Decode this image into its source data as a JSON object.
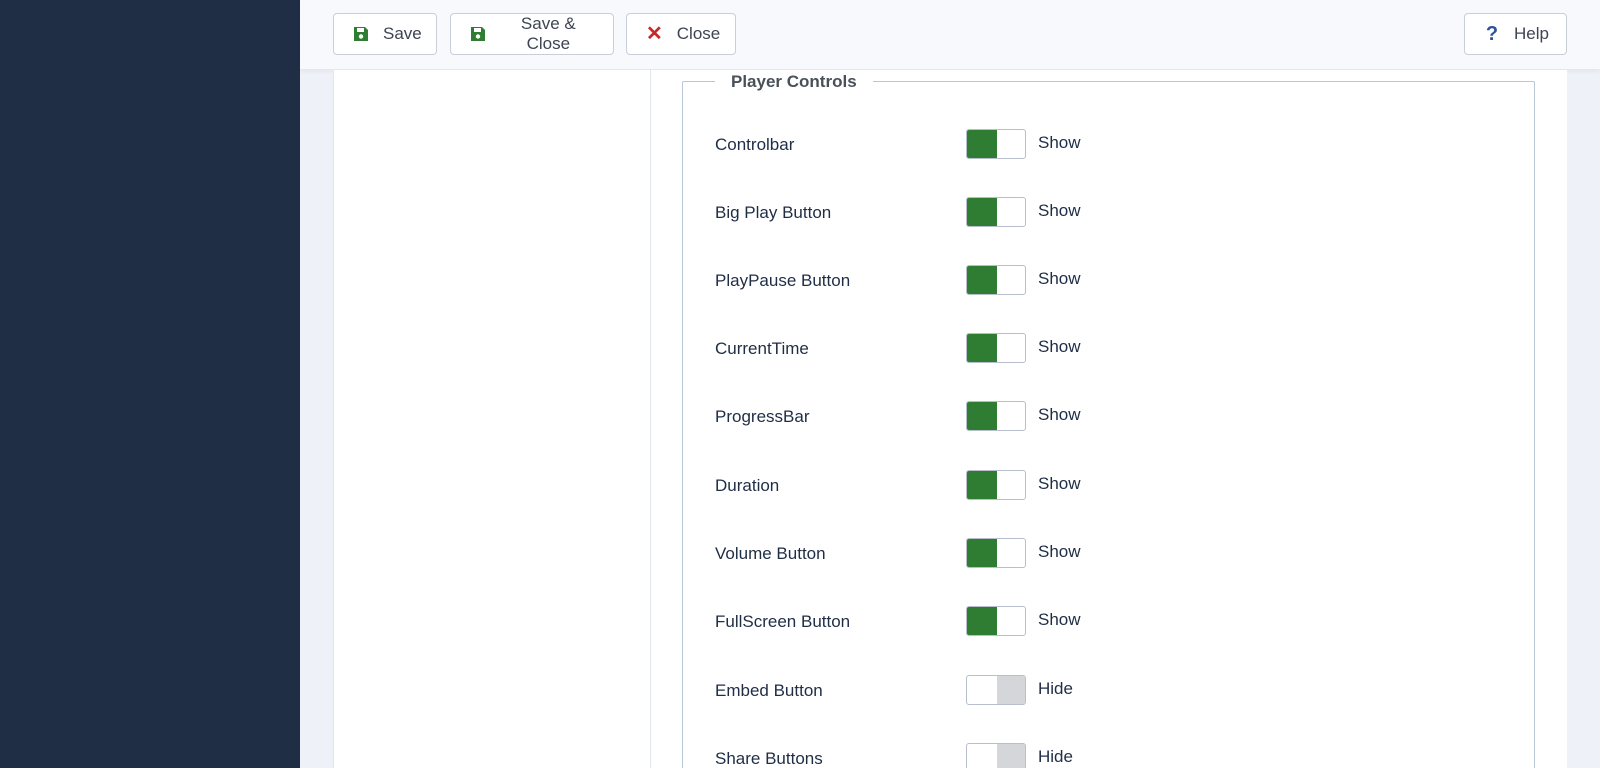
{
  "toolbar": {
    "save_label": "Save",
    "save_close_label": "Save & Close",
    "close_label": "Close",
    "help_label": "Help"
  },
  "colors": {
    "sidebar": "#1f2d45",
    "toggle_on": "#2e7d32",
    "toggle_off": "#d4d6d9",
    "close_icon": "#c62828",
    "help_icon": "#2a5598"
  },
  "fieldset": {
    "legend": "Player Controls",
    "rows": [
      {
        "label": "Controlbar",
        "state": "Show",
        "on": true
      },
      {
        "label": "Big Play Button",
        "state": "Show",
        "on": true
      },
      {
        "label": "PlayPause Button",
        "state": "Show",
        "on": true
      },
      {
        "label": "CurrentTime",
        "state": "Show",
        "on": true
      },
      {
        "label": "ProgressBar",
        "state": "Show",
        "on": true
      },
      {
        "label": "Duration",
        "state": "Show",
        "on": true
      },
      {
        "label": "Volume Button",
        "state": "Show",
        "on": true
      },
      {
        "label": "FullScreen Button",
        "state": "Show",
        "on": true
      },
      {
        "label": "Embed Button",
        "state": "Hide",
        "on": false
      },
      {
        "label": "Share Buttons",
        "state": "Hide",
        "on": false
      }
    ]
  }
}
